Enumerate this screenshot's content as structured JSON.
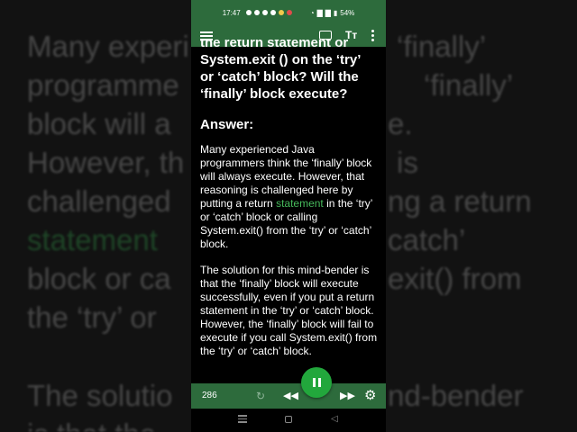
{
  "status": {
    "time": "17:47",
    "battery": "54%"
  },
  "toolbar": {
    "menu_icon": "hamburger-icon",
    "keyboard_icon": "keyboard-icon",
    "text_size_label": "Tт",
    "more_icon": "more-vertical-icon"
  },
  "article": {
    "question_lines": [
      "the return statement or",
      "System.exit () on the ‘try’",
      "or ‘catch’ block? Will the",
      "‘finally’ block execute?"
    ],
    "answer_heading": "Answer:",
    "para1_before": "Many experienced Java programmers think the ‘finally’ block will always execute. However, that reasoning is challenged here by putting a return ",
    "para1_link": "statement",
    "para1_after": " in the ‘try’ or ‘catch’ block or calling System.exit() from the ‘try’ or ‘catch’ block.",
    "para2": "The solution for this mind-bender is that the ‘finally’ block will execute successfully, even if you put a return statement in the ‘try’ or ‘catch’ block. However, the ‘finally’ block will fail to execute if you call System.exit() from the ‘try’ or ‘catch’ block."
  },
  "player": {
    "count": "286",
    "repeat_icon": "repeat-icon",
    "rewind_icon": "rewind-icon",
    "pause_icon": "pause-icon",
    "fast_forward_icon": "fast-forward-icon",
    "settings_icon": "gear-icon"
  },
  "background": {
    "lines": [
      {
        "text": "Many experi",
        "tail": "‘finally’"
      },
      {
        "text": "programme",
        "tail": "‘finally’"
      },
      {
        "text": "block will a",
        "tail": "e."
      },
      {
        "text": "However, th",
        "tail": "is"
      },
      {
        "text": "challenged",
        "tail": "ng a return"
      },
      {
        "text": "statement",
        "tail": "catch’"
      },
      {
        "text": "block or ca",
        "tail": "exit() from"
      },
      {
        "text": "the ‘try’ or",
        "tail": ""
      },
      {
        "text": "The solutio",
        "tail": "nd-bender"
      },
      {
        "text": "is that the",
        "tail": ""
      }
    ]
  }
}
